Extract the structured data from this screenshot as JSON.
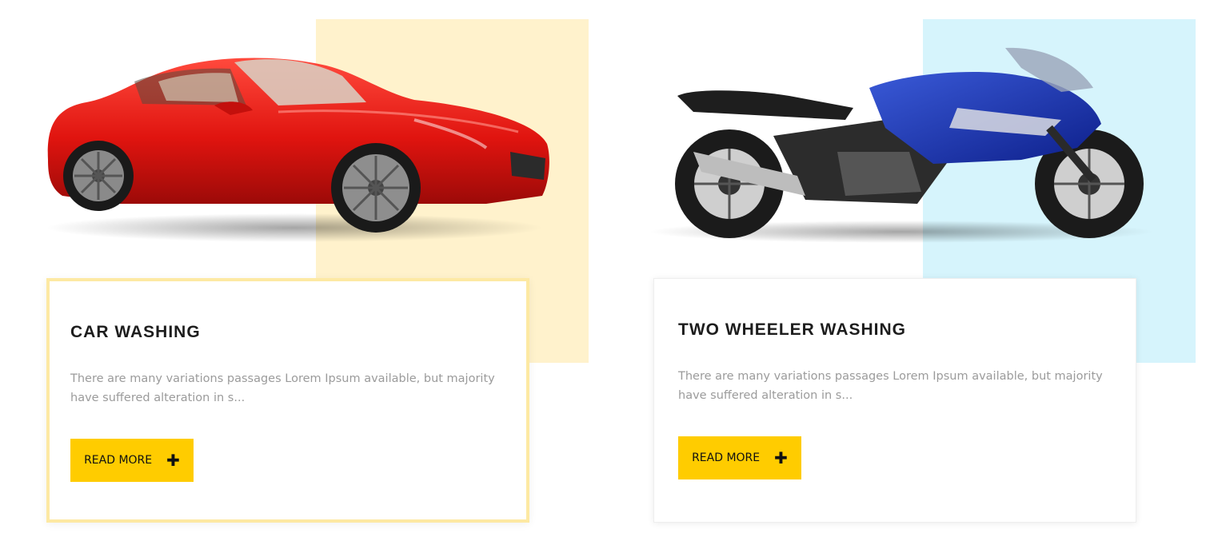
{
  "colors": {
    "accent": "#ffcc00",
    "car_bg": "#fff2cc",
    "bike_bg": "#d6f4fc",
    "title": "#1d1d1d",
    "text": "#9b9b9b"
  },
  "services": [
    {
      "title": "CAR WASHING",
      "description": "There are many variations passages Lorem Ipsum available, but majority have suffered alteration in s...",
      "button_label": "READ MORE",
      "button_icon": "plus-icon",
      "image": "red-sports-car-image"
    },
    {
      "title": "TWO WHEELER WASHING",
      "description": "There are many variations passages Lorem Ipsum available, but majority have suffered alteration in s...",
      "button_label": "READ MORE",
      "button_icon": "plus-icon",
      "image": "blue-motorcycle-image"
    }
  ]
}
